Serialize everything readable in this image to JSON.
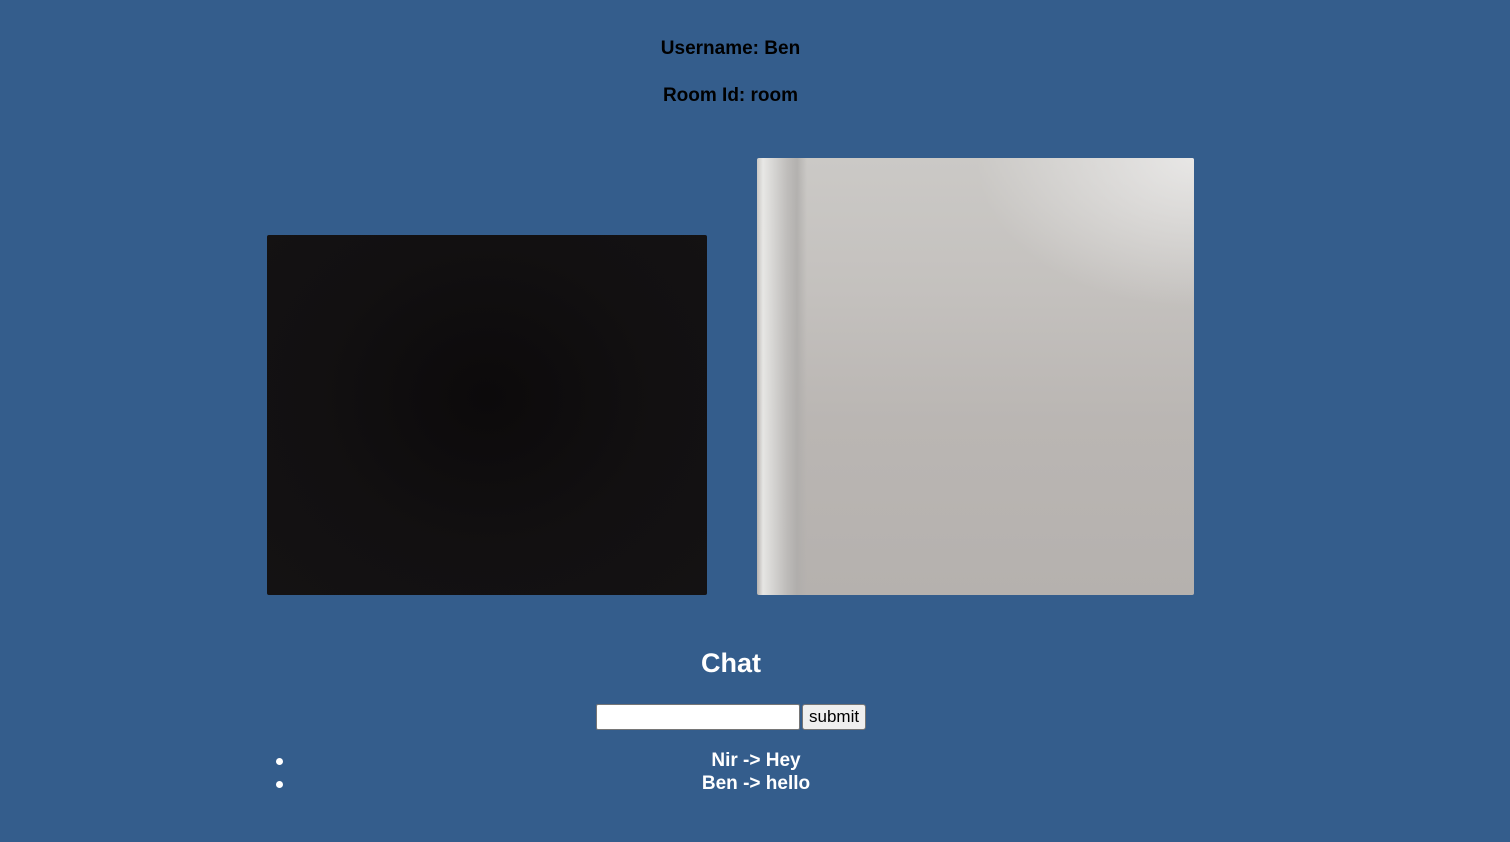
{
  "header": {
    "username": "Username: Ben",
    "room_id": "Room Id: room"
  },
  "chat": {
    "title": "Chat",
    "input_value": "",
    "submit_label": "submit",
    "messages": [
      {
        "text": "Nir -> Hey"
      },
      {
        "text": "Ben -> hello"
      }
    ]
  },
  "colors": {
    "background": "#345d8c",
    "text_primary": "#000000",
    "text_chat": "#ffffff"
  }
}
